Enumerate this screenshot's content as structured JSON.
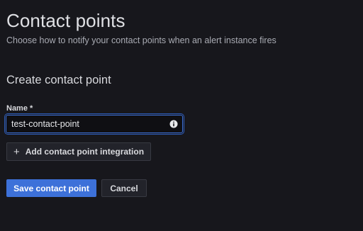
{
  "header": {
    "title": "Contact points",
    "subtitle": "Choose how to notify your contact points when an alert instance fires"
  },
  "form": {
    "section_title": "Create contact point",
    "name_label": "Name *",
    "name_value": "test-contact-point",
    "add_integration_label": "Add contact point integration",
    "save_label": "Save contact point",
    "cancel_label": "Cancel"
  },
  "icons": {
    "info": "info-icon",
    "plus": "plus-icon"
  },
  "colors": {
    "background": "#17171c",
    "primary": "#3d71d9",
    "secondary_button": "#22232a"
  }
}
